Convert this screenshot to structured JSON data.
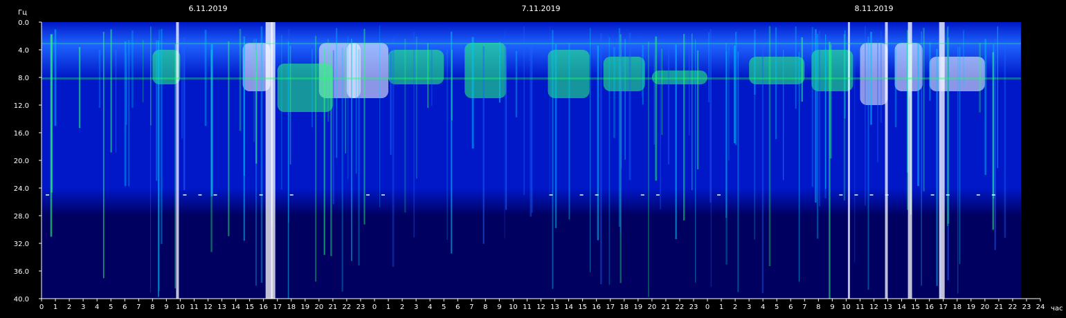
{
  "chart_data": {
    "type": "heatmap",
    "title": "",
    "ylabel": "Гц",
    "xlabel": "час",
    "dates": [
      "6.11.2019",
      "7.11.2019",
      "8.11.2019"
    ],
    "date_hours": [
      12,
      36,
      60
    ],
    "ylim": [
      40.0,
      0.0
    ],
    "yticks": [
      0.0,
      4.0,
      8.0,
      12.0,
      16.0,
      20.0,
      24.0,
      28.0,
      32.0,
      36.0,
      40.0
    ],
    "yticklabels": [
      "0.0",
      "4.0",
      "8.0",
      "12.0",
      "16.0",
      "20.0",
      "24.0",
      "28.0",
      "32.0",
      "36.0",
      "40.0"
    ],
    "xlim": [
      0,
      72
    ],
    "xticklabels": [
      "0",
      "1",
      "2",
      "3",
      "4",
      "5",
      "6",
      "7",
      "8",
      "9",
      "10",
      "11",
      "12",
      "13",
      "14",
      "15",
      "16",
      "17",
      "18",
      "19",
      "20",
      "21",
      "22",
      "23",
      "0",
      "1",
      "2",
      "3",
      "4",
      "5",
      "6",
      "7",
      "8",
      "9",
      "10",
      "11",
      "12",
      "13",
      "14",
      "15",
      "16",
      "17",
      "18",
      "19",
      "20",
      "21",
      "22",
      "23",
      "0",
      "1",
      "2",
      "3",
      "4",
      "5",
      "6",
      "7",
      "8",
      "9",
      "10",
      "11",
      "12",
      "13",
      "14",
      "15",
      "16",
      "17",
      "18",
      "19",
      "20",
      "21",
      "22",
      "23",
      "24"
    ],
    "data_end_hour": 70.6,
    "colorscale": [
      "#000060",
      "#0018c8",
      "#1e64ff",
      "#00c8ff",
      "#28ff78",
      "#e63c00",
      "#ffffff"
    ],
    "grid": false,
    "legend": "none"
  }
}
